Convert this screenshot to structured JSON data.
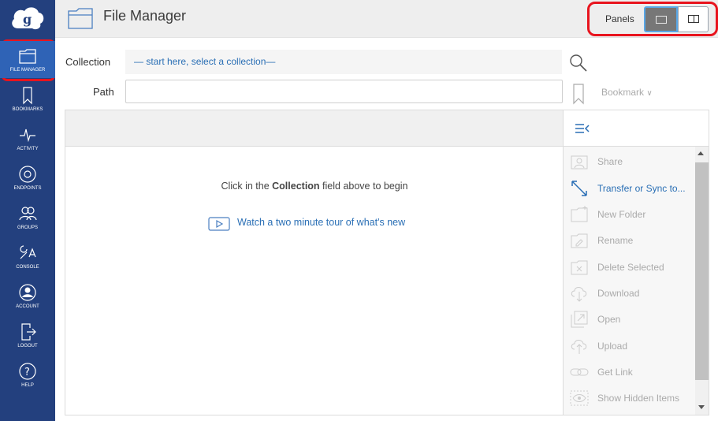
{
  "sidebar": {
    "logo": "globus-logo",
    "items": [
      {
        "label": "FILE MANAGER",
        "icon": "folder-icon"
      },
      {
        "label": "BOOKMARKS",
        "icon": "bookmark-icon"
      },
      {
        "label": "ACTIVITY",
        "icon": "activity-icon"
      },
      {
        "label": "ENDPOINTS",
        "icon": "endpoints-icon"
      },
      {
        "label": "GROUPS",
        "icon": "groups-icon"
      },
      {
        "label": "CONSOLE",
        "icon": "console-icon"
      },
      {
        "label": "ACCOUNT",
        "icon": "account-icon"
      },
      {
        "label": "LOGOUT",
        "icon": "logout-icon"
      },
      {
        "label": "HELP",
        "icon": "help-icon"
      }
    ]
  },
  "header": {
    "title": "File Manager",
    "panels_label": "Panels"
  },
  "collection": {
    "label": "Collection",
    "placeholder": "— start here, select a collection—"
  },
  "path": {
    "label": "Path",
    "value": ""
  },
  "bookmark": {
    "label": "Bookmark"
  },
  "main": {
    "hint_prefix": "Click in the ",
    "hint_bold": "Collection",
    "hint_suffix": " field above to begin",
    "tour_link": "Watch a two minute tour of what's new"
  },
  "actions": [
    {
      "label": "Share",
      "icon": "share-icon",
      "enabled": false
    },
    {
      "label": "Transfer or Sync to...",
      "icon": "transfer-icon",
      "enabled": true
    },
    {
      "label": "New Folder",
      "icon": "new-folder-icon",
      "enabled": false
    },
    {
      "label": "Rename",
      "icon": "rename-icon",
      "enabled": false
    },
    {
      "label": "Delete Selected",
      "icon": "delete-icon",
      "enabled": false
    },
    {
      "label": "Download",
      "icon": "download-icon",
      "enabled": false
    },
    {
      "label": "Open",
      "icon": "open-icon",
      "enabled": false
    },
    {
      "label": "Upload",
      "icon": "upload-icon",
      "enabled": false
    },
    {
      "label": "Get Link",
      "icon": "link-icon",
      "enabled": false
    },
    {
      "label": "Show Hidden Items",
      "icon": "eye-icon",
      "enabled": false
    }
  ],
  "colors": {
    "sidebar": "#23407e",
    "active_nav": "#2f63b6",
    "link": "#2a6fb5",
    "highlight_outline": "#e8141e"
  }
}
